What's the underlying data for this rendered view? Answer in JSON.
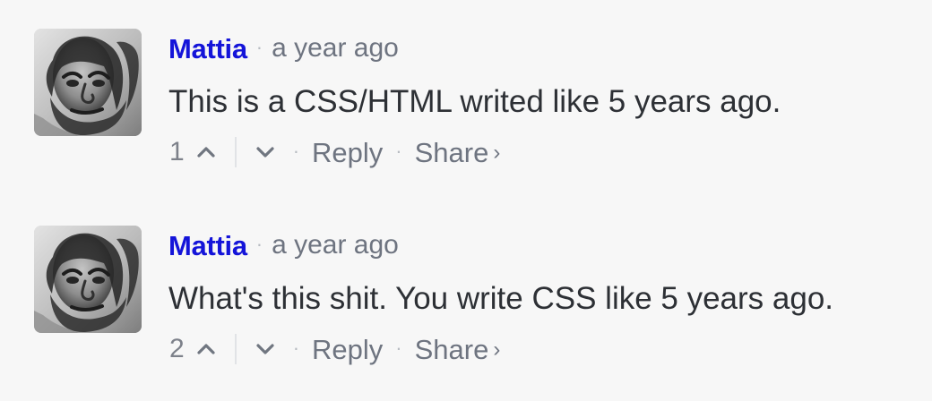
{
  "comments": [
    {
      "author": "Mattia",
      "time": "a year ago",
      "text": "This is a CSS/HTML writed like 5 years ago.",
      "votes": "1",
      "reply_label": "Reply",
      "share_label": "Share",
      "share_arrow": "›"
    },
    {
      "author": "Mattia",
      "time": "a year ago",
      "text": "What's this shit. You write CSS like 5 years ago.",
      "votes": "2",
      "reply_label": "Reply",
      "share_label": "Share",
      "share_arrow": "›"
    }
  ],
  "icons": {
    "avatar": "avatar",
    "upvote": "chevron-up-icon",
    "downvote": "chevron-down-icon",
    "share_arrow": "chevron-right-icon"
  },
  "colors": {
    "background": "#f7f7f7",
    "author": "#1414d9",
    "body_text": "#2d3035",
    "muted_text": "#6e7480",
    "separator": "#e1e3e6"
  },
  "separators": {
    "dot": "·"
  }
}
